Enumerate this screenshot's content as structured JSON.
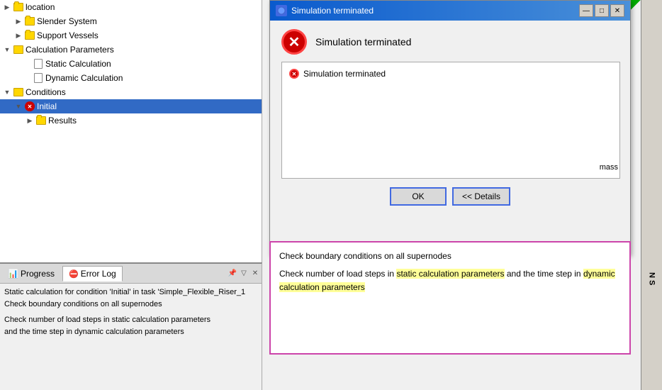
{
  "leftPanel": {
    "treeItems": [
      {
        "id": "location",
        "label": "location",
        "level": 1,
        "expandIcon": "▶",
        "hasFolder": true,
        "folderOpen": false
      },
      {
        "id": "slender-system",
        "label": "Slender System",
        "level": 2,
        "expandIcon": "▶",
        "hasFolder": true
      },
      {
        "id": "support-vessels",
        "label": "Support Vessels",
        "level": 2,
        "expandIcon": "▶",
        "hasFolder": true
      },
      {
        "id": "calc-params",
        "label": "Calculation Parameters",
        "level": 1,
        "expandIcon": "▼",
        "hasFolder": true,
        "folderOpen": true
      },
      {
        "id": "static-calc",
        "label": "Static Calculation",
        "level": 2,
        "expandIcon": "",
        "hasDoc": true
      },
      {
        "id": "dynamic-calc",
        "label": "Dynamic Calculation",
        "level": 2,
        "expandIcon": "",
        "hasDoc": true
      },
      {
        "id": "conditions",
        "label": "Conditions",
        "level": 1,
        "expandIcon": "▼",
        "hasFolder": true,
        "folderOpen": true
      },
      {
        "id": "initial",
        "label": "Initial",
        "level": 2,
        "expandIcon": "▼",
        "hasRedCircle": true,
        "selected": true
      },
      {
        "id": "results",
        "label": "Results",
        "level": 3,
        "expandIcon": "▶",
        "hasFolder": true
      }
    ]
  },
  "bottomPanel": {
    "tabs": [
      {
        "id": "progress",
        "label": "Progress",
        "active": false
      },
      {
        "id": "error-log",
        "label": "Error Log",
        "active": true,
        "hasErrorIcon": true
      }
    ],
    "content": [
      "Static calculation for condition 'Initial' in task 'Simple_Flexible_Riser_1",
      "Check boundary conditions on all supernodes",
      "",
      "Check number of load steps in static calculation parameters",
      "and the time step in dynamic calculation parameters"
    ]
  },
  "dialog": {
    "title": "Simulation terminated",
    "titleIcon": "⚙",
    "buttons": {
      "ok": "OK",
      "details": "<< Details"
    },
    "headerMessage": "Simulation terminated",
    "messages": [
      "Simulation terminated"
    ],
    "details": {
      "line1": "Check boundary conditions on all supernodes",
      "line2": "Check number of load steps in",
      "highlightedText": "static calculation parameters",
      "line3": " and the time step in",
      "highlightedText2": "dynamic calculation parameters"
    }
  },
  "titleButtons": {
    "minimize": "—",
    "maximize": "□",
    "close": "✕"
  },
  "sideLabels": {
    "mass": "mass",
    "ns": "N S"
  }
}
